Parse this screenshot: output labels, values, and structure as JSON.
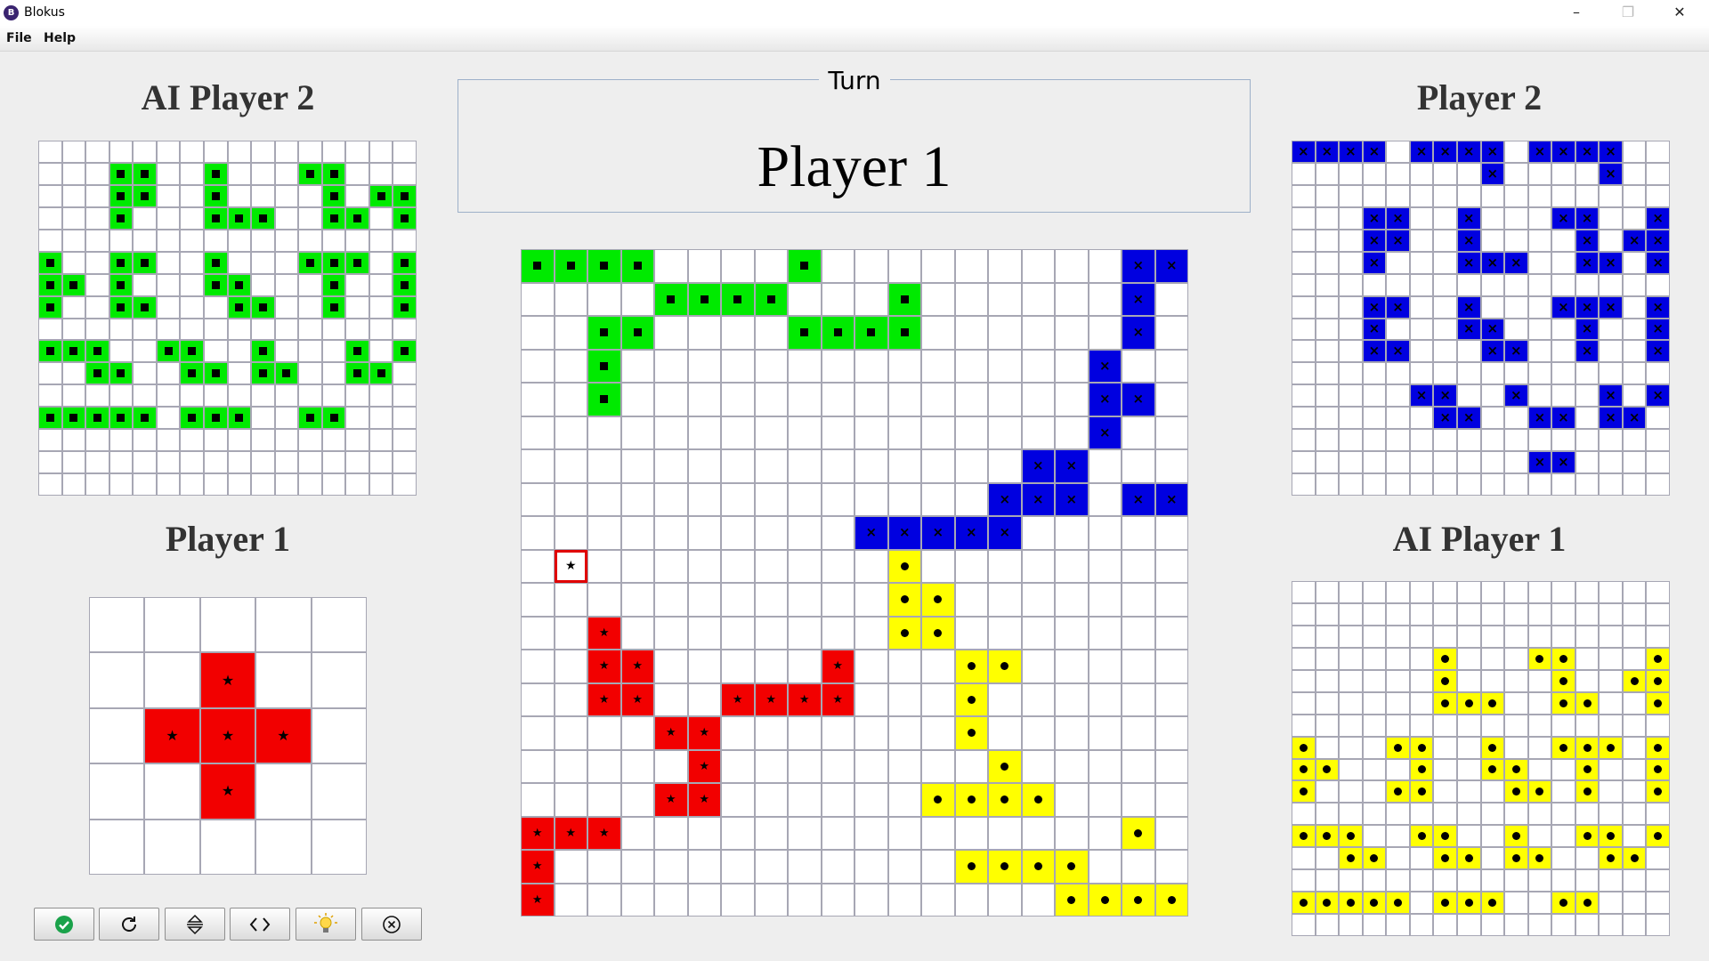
{
  "window": {
    "title": "Blokus",
    "app_icon": "game-logo-icon",
    "minimize": "–",
    "maximize": "❐",
    "close": "✕"
  },
  "menu": {
    "items": [
      {
        "label": "File"
      },
      {
        "label": "Help"
      }
    ]
  },
  "turn": {
    "label": "Turn",
    "player": "Player 1"
  },
  "colors": {
    "green": "#00ea00",
    "blue": "#0000e0",
    "yellow": "#ffff00",
    "red": "#f20000",
    "grid_line": "#a7a7b4",
    "selection": "#e00000"
  },
  "panels": {
    "top_left": {
      "title": "AI Player 2",
      "color": "green",
      "marker": "square",
      "rows": [
        "................",
        "...11..1...11...",
        "...11..1....1.11",
        "...1...111..11.1",
        "................",
        "1..11..1...111.1",
        "11.1...11...1..1",
        "1..11...11..1..1",
        "................",
        "111..11..1...1.1",
        "..11..11.11..11.",
        "................",
        "11111.111..11...",
        "................",
        "................",
        "................"
      ]
    },
    "bottom_left": {
      "title": "Player 1",
      "color": "red",
      "marker": "star",
      "rows": [
        ".....",
        "..1..",
        ".111.",
        "..1..",
        "....."
      ]
    },
    "top_right": {
      "title": "Player 2",
      "color": "blue",
      "marker": "cross",
      "rows": [
        "1111.1111.1111..",
        "........1....1..",
        "................",
        "...11..1...11..1",
        "...11..1....1.11",
        "...1...111..11.1",
        "................",
        "...11..1...111.1",
        "...1...11...1..1",
        "...11...11..1..1",
        "................",
        ".....11..1...1.1",
        "......11..11.11.",
        "................",
        "..........11....",
        "................"
      ]
    },
    "bottom_right": {
      "title": "AI Player 1",
      "color": "yellow",
      "marker": "circle",
      "rows": [
        "................",
        "................",
        "................",
        "......1...11...1",
        "......1....1..11",
        "......111..11..1",
        "................",
        "1...11..1..111.1",
        "11...1..11..1..1",
        "1...11...11.1..1",
        "................",
        "111..11..1..11.1",
        "..11..11.11..11.",
        "................",
        "11111.111..11...",
        "................"
      ]
    }
  },
  "board": {
    "size": 20,
    "rows": [
      "GGGG....G.........BB",
      "....GGGG...G......B.",
      "..GG....GGGG......B.",
      "..G..............B..",
      "..G..............BB.",
      ".................B..",
      "...............BB...",
      "..............BBB.BBB",
      "..........BBBBB.....",
      ".S.........Y........",
      "...........YY.......",
      "..R........YY.......",
      "..RR.....R...YY.....",
      "..RR..RRRR...Y......",
      "....RR.......Y......",
      ".....R........Y.....",
      "....RR......YYYY....",
      "RRR...............Y.",
      "R............YYYY...",
      "R...............YYYY"
    ],
    "selected_cell": {
      "row": 9,
      "col": 1
    }
  },
  "toolbar": {
    "buttons": [
      {
        "name": "confirm-button",
        "icon": "check-circle-icon"
      },
      {
        "name": "rotate-button",
        "icon": "rotate-icon"
      },
      {
        "name": "flip-vertical-button",
        "icon": "flip-vertical-icon"
      },
      {
        "name": "flip-horizontal-button",
        "icon": "flip-horizontal-icon"
      },
      {
        "name": "hint-button",
        "icon": "lightbulb-icon"
      },
      {
        "name": "cancel-button",
        "icon": "close-circle-icon"
      }
    ]
  }
}
